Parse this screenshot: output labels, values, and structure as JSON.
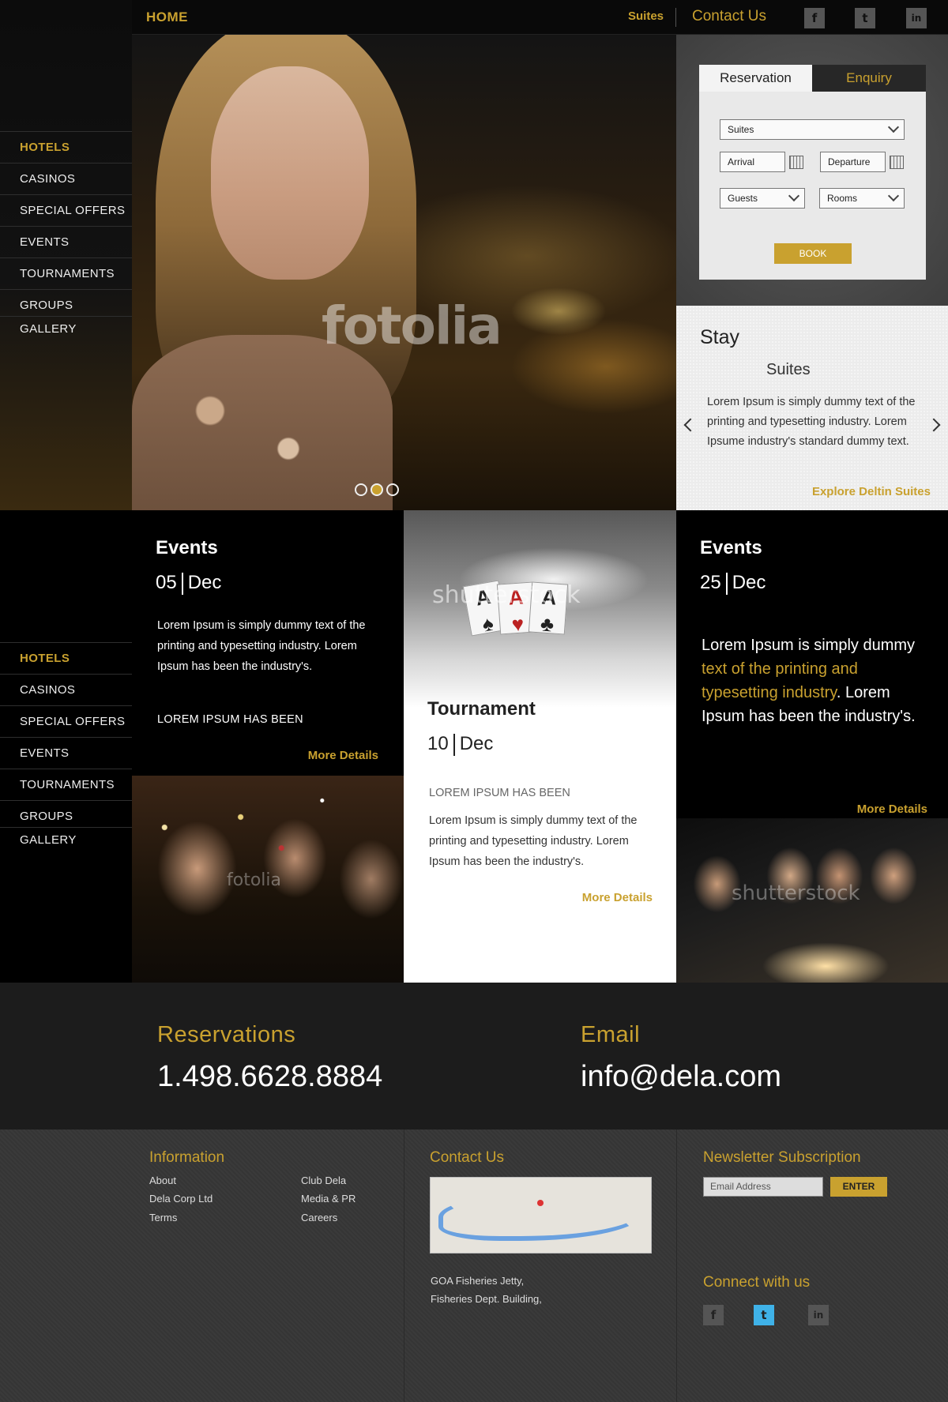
{
  "nav": {
    "home": "HOME",
    "suites": "Suites",
    "contact": "Contact Us",
    "social": [
      {
        "icon": "facebook-icon",
        "glyph": "f"
      },
      {
        "icon": "twitter-icon",
        "glyph": "t"
      },
      {
        "icon": "linkedin-icon",
        "glyph": "in"
      }
    ]
  },
  "sidebar": {
    "items": [
      "HOTELS",
      "CASINOS",
      "SPECIAL OFFERS",
      "EVENTS",
      "TOURNAMENTS",
      "GROUPS",
      "GALLERY"
    ],
    "active": "HOTELS"
  },
  "hero": {
    "watermark": "fotolia",
    "slides": 3,
    "active_slide": 2
  },
  "reservation": {
    "tab_reservation": "Reservation",
    "tab_enquiry": "Enquiry",
    "type_value": "Suites",
    "arrival_placeholder": "Arrival",
    "departure_placeholder": "Departure",
    "guests_value": "Guests",
    "rooms_value": "Rooms",
    "book_label": "BOOK"
  },
  "stay": {
    "title": "Stay",
    "subtitle": "Suites",
    "body": "Lorem Ipsum is simply dummy text of the printing and typesetting industry. Lorem Ipsume industry's standard dummy text.",
    "link": "Explore Deltin Suites"
  },
  "events": [
    {
      "title": "Events",
      "day": "05",
      "month": "Dec",
      "body": "Lorem Ipsum is simply dummy text of the printing and typesetting industry. Lorem Ipsum has been the industry's.",
      "caps": "LOREM IPSUM HAS BEEN",
      "more": "More Details",
      "watermark": "fotolia"
    },
    {
      "title": "Tournament",
      "day": "10",
      "month": "Dec",
      "caps": "LOREM IPSUM HAS BEEN",
      "body": "Lorem Ipsum is simply dummy text of the printing and typesetting industry. Lorem Ipsum has been the industry's.",
      "more": "More Details",
      "watermark": "shutterstock"
    },
    {
      "title": "Events",
      "day": "25",
      "month": "Dec",
      "body_a": "Lorem Ipsum is simply dummy ",
      "body_b": "text of the printing and typesetting industry",
      "body_c": ". Lorem Ipsum has been the industry's.",
      "more": "More Details",
      "watermark": "shutterstock"
    }
  ],
  "band": {
    "reservations_label": "Reservations",
    "phone": "1.498.6628.8884",
    "email_label": "Email",
    "email": "info@dela.com"
  },
  "footer": {
    "info_title": "Information",
    "info_col1": [
      "About",
      "Dela Corp Ltd",
      "Terms"
    ],
    "info_col2": [
      "Club Dela",
      "Media & PR",
      "Careers"
    ],
    "contact_title": "Contact Us",
    "address_line1": "GOA Fisheries Jetty,",
    "address_line2": "Fisheries Dept. Building,",
    "newsletter_title": "Newsletter Subscription",
    "email_placeholder": "Email Address",
    "enter_label": "ENTER",
    "connect_title": "Connect with us"
  },
  "colors": {
    "accent": "#c9a12f",
    "twitter_active": "#3fb2e8"
  }
}
